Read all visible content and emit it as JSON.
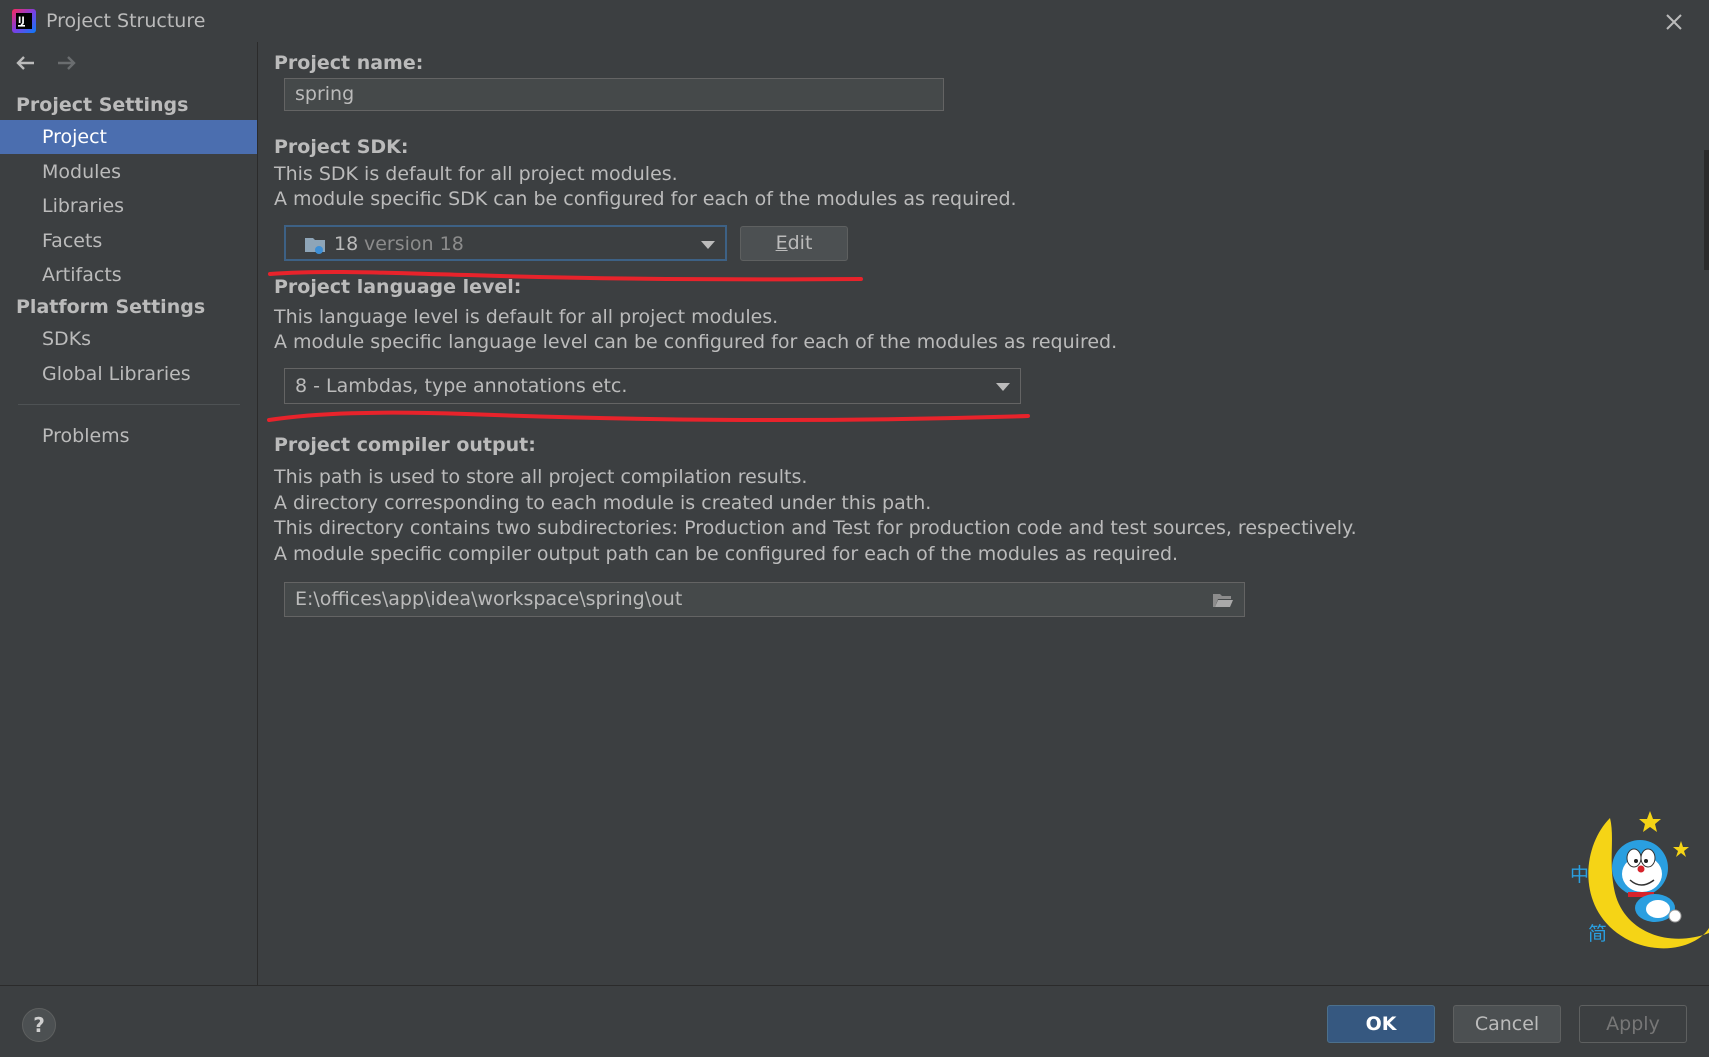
{
  "window": {
    "title": "Project Structure"
  },
  "sidebar": {
    "project_settings_title": "Project Settings",
    "project_items": [
      "Project",
      "Modules",
      "Libraries",
      "Facets",
      "Artifacts"
    ],
    "platform_settings_title": "Platform Settings",
    "platform_items": [
      "SDKs",
      "Global Libraries"
    ],
    "problems": "Problems",
    "selected": "Project"
  },
  "project": {
    "name_label": "Project name:",
    "name_value": "spring",
    "sdk_label": "Project SDK:",
    "sdk_desc_1": "This SDK is default for all project modules.",
    "sdk_desc_2": "A module specific SDK can be configured for each of the modules as required.",
    "sdk_name": "18",
    "sdk_version": "version 18",
    "edit_label_prefix": "",
    "edit_mnemonic": "E",
    "edit_label_rest": "dit",
    "lang_label": "Project language level:",
    "lang_desc_1": "This language level is default for all project modules.",
    "lang_desc_2": "A module specific language level can be configured for each of the modules as required.",
    "lang_value": "8 - Lambdas, type annotations etc.",
    "output_label": "Project compiler output:",
    "output_desc_1": "This path is used to store all project compilation results.",
    "output_desc_2": "A directory corresponding to each module is created under this path.",
    "output_desc_3": "This directory contains two subdirectories: Production and Test for production code and test sources, respectively.",
    "output_desc_4": "A module specific compiler output path can be configured for each of the modules as required.",
    "output_path": "E:\\offices\\app\\idea\\workspace\\spring\\out"
  },
  "footer": {
    "help": "?",
    "ok": "OK",
    "cancel": "Cancel",
    "apply": "Apply"
  },
  "mascot_text": [
    "中",
    "简"
  ],
  "colors": {
    "background": "#3c3f41",
    "selection": "#4b6eaf",
    "annotation_red": "#e8232b",
    "primary_button": "#365880"
  }
}
